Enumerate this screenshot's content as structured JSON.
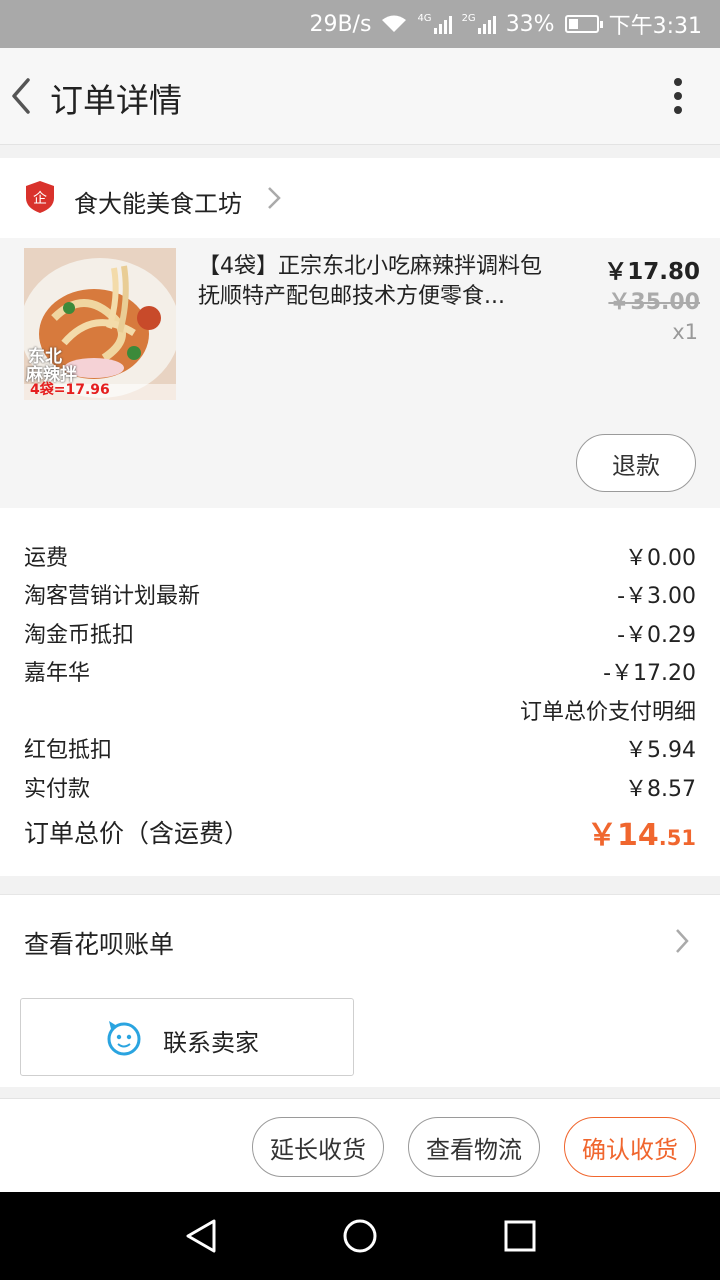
{
  "status_bar": {
    "net_speed": "29B/s",
    "signal1_label": "4G",
    "signal2_label": "2G",
    "battery": "33%",
    "time": "下午3:31",
    "battery_level": 0.33
  },
  "header": {
    "title": "订单详情"
  },
  "shop": {
    "name": "食大能美食工坊"
  },
  "product": {
    "title": "【4袋】正宗东北小吃麻辣拌调料包 抚顺特产配包邮技术方便零食...",
    "price": "￥17.80",
    "original_price": "￥35.00",
    "quantity": "x1",
    "refund_label": "退款",
    "thumb_text_line1": "东北",
    "thumb_text_line2": "麻辣拌",
    "thumb_text_line3": "4袋=17.96"
  },
  "fees": [
    {
      "label": "运费",
      "value": "￥0.00"
    },
    {
      "label": "淘客营销计划最新",
      "value": "-￥3.00"
    },
    {
      "label": "淘金币抵扣",
      "value": "-￥0.29"
    },
    {
      "label": "嘉年华",
      "value": "-￥17.20"
    },
    {
      "label": "",
      "value": "订单总价支付明细"
    },
    {
      "label": "红包抵扣",
      "value": "￥5.94"
    },
    {
      "label": "实付款",
      "value": "￥8.57"
    }
  ],
  "total": {
    "label": "订单总价（含运费）",
    "currency": "￥",
    "integer": "14",
    "decimal": ".51"
  },
  "huabei": {
    "label": "查看花呗账单"
  },
  "contact": {
    "label": "联系卖家"
  },
  "actions": {
    "extend": "延长收货",
    "logistics": "查看物流",
    "confirm": "确认收货"
  },
  "colors": {
    "accent": "#f0662e",
    "status_bar": "#a9a9a9",
    "shop_badge": "#d9322c",
    "contact_icon": "#2aa4e0"
  }
}
